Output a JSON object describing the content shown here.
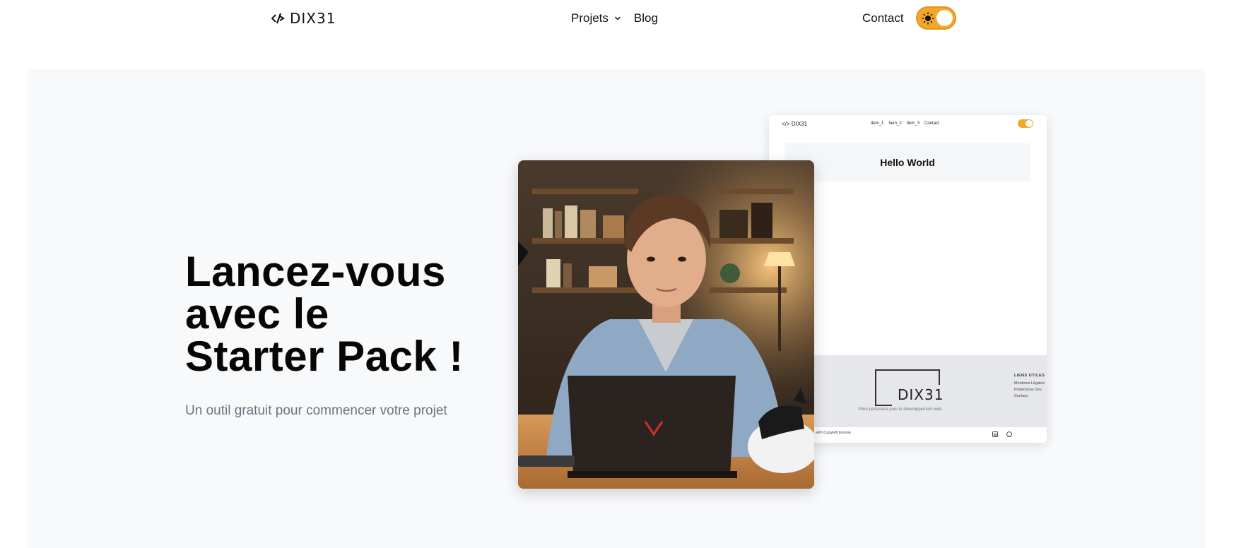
{
  "header": {
    "logo_text": "DIX31",
    "nav": [
      {
        "label": "Projets",
        "has_dropdown": true
      },
      {
        "label": "Blog",
        "has_dropdown": false
      }
    ],
    "contact_label": "Contact",
    "theme_toggle": {
      "state": "light",
      "accent": "#f2a62a"
    }
  },
  "hero": {
    "title_lines": [
      "Lancez-vous",
      "avec le",
      "Starter Pack !"
    ],
    "subtitle": "Un outil gratuit pour commencer votre projet"
  },
  "mock": {
    "logo_text": "DIX31",
    "nav": [
      "Item_1",
      "Item_2",
      "Item_3",
      "Contact"
    ],
    "hello": "Hello World",
    "footer_brand": "DIX31",
    "footer_tagline": "Votre partenaire pour le développement web",
    "links_title": "LIENS UTILES",
    "links": [
      "Mentions Légales",
      "Protections Des",
      "Contact"
    ],
    "license": "with Copyleft license"
  },
  "colors": {
    "accent": "#f2a62a",
    "hero_bg": "#f8f9fb",
    "subtitle": "#6b7280"
  }
}
